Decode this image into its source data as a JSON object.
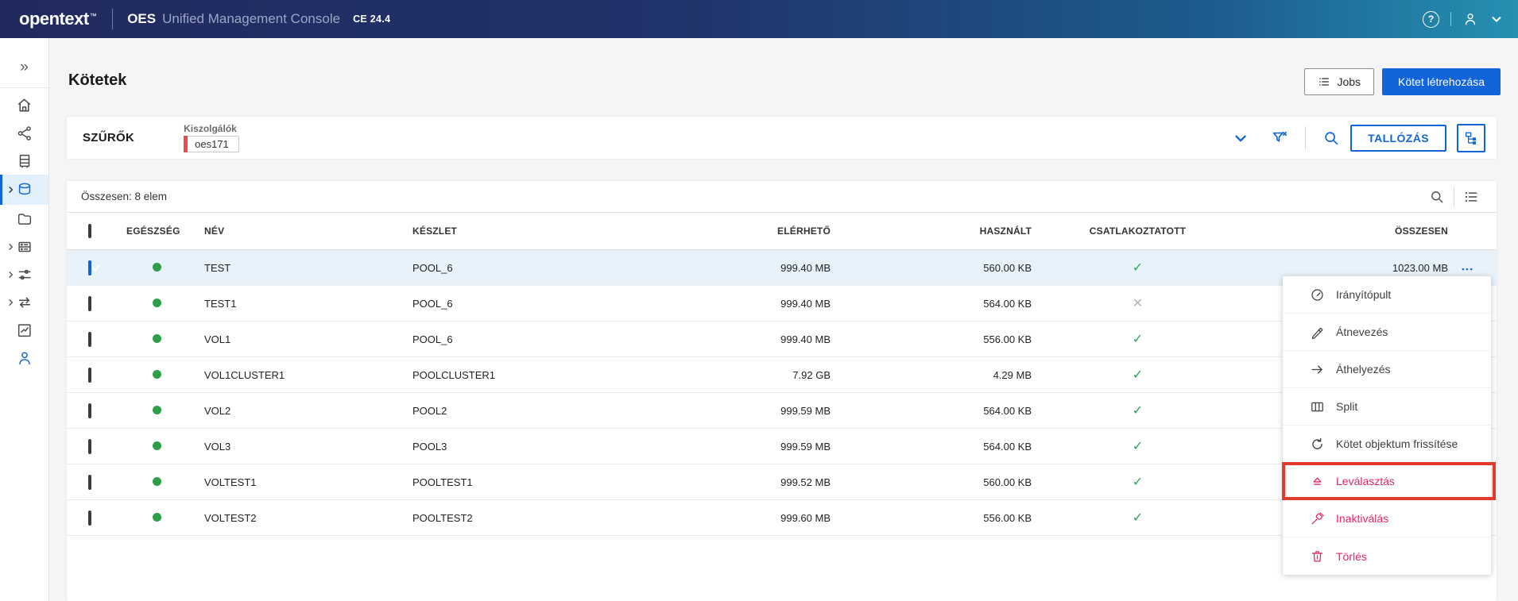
{
  "header": {
    "logo": "opentext",
    "trademark": "™",
    "app_bold": "OES",
    "app_name": "Unified Management Console",
    "version": "CE 24.4"
  },
  "toolbar": {
    "title": "Kötetek",
    "jobs_label": "Jobs",
    "create_label": "Kötet létrehozása"
  },
  "filter_bar": {
    "title": "SZŰRŐK",
    "field_label": "Kiszolgálók",
    "chip_value": "oes171",
    "browse_label": "TALLÓZÁS"
  },
  "table": {
    "summary": "Összesen: 8 elem",
    "columns": {
      "health": "EGÉSZSÉG",
      "name": "NÉV",
      "pool": "KÉSZLET",
      "available": "ELÉRHETŐ",
      "used": "HASZNÁLT",
      "mounted": "CSATLAKOZTATOTT",
      "total": "ÖSSZESEN"
    },
    "rows": [
      {
        "name": "TEST",
        "pool": "POOL_6",
        "available": "999.40 MB",
        "used": "560.00 KB",
        "mounted": "yes",
        "total": "1023.00 MB",
        "selected": true
      },
      {
        "name": "TEST1",
        "pool": "POOL_6",
        "available": "999.40 MB",
        "used": "564.00 KB",
        "mounted": "no",
        "total": "",
        "selected": false
      },
      {
        "name": "VOL1",
        "pool": "POOL_6",
        "available": "999.40 MB",
        "used": "556.00 KB",
        "mounted": "yes",
        "total": "",
        "selected": false
      },
      {
        "name": "VOL1CLUSTER1",
        "pool": "POOLCLUSTER1",
        "available": "7.92 GB",
        "used": "4.29 MB",
        "mounted": "yes",
        "total": "",
        "selected": false
      },
      {
        "name": "VOL2",
        "pool": "POOL2",
        "available": "999.59 MB",
        "used": "564.00 KB",
        "mounted": "yes",
        "total": "",
        "selected": false
      },
      {
        "name": "VOL3",
        "pool": "POOL3",
        "available": "999.59 MB",
        "used": "564.00 KB",
        "mounted": "yes",
        "total": "",
        "selected": false
      },
      {
        "name": "VOLTEST1",
        "pool": "POOLTEST1",
        "available": "999.52 MB",
        "used": "560.00 KB",
        "mounted": "yes",
        "total": "",
        "selected": false
      },
      {
        "name": "VOLTEST2",
        "pool": "POOLTEST2",
        "available": "999.60 MB",
        "used": "556.00 KB",
        "mounted": "yes",
        "total": "",
        "selected": false
      }
    ]
  },
  "context_menu": {
    "items": [
      {
        "label": "Irányítópult",
        "icon": "dashboard-icon"
      },
      {
        "label": "Átnevezés",
        "icon": "rename-icon"
      },
      {
        "label": "Áthelyezés",
        "icon": "move-icon"
      },
      {
        "label": "Split",
        "icon": "split-icon"
      },
      {
        "label": "Kötet objektum frissítése",
        "icon": "refresh-icon"
      },
      {
        "label": "Leválasztás",
        "icon": "eject-icon",
        "danger": true,
        "annotated": true
      },
      {
        "label": "Inaktiválás",
        "icon": "deactivate-icon",
        "danger": true
      },
      {
        "label": "Törlés",
        "icon": "delete-icon",
        "danger": true
      }
    ]
  },
  "icons": {
    "header": [
      "help-icon",
      "user-icon",
      "chevron-down-icon"
    ],
    "sidebar": [
      "expand-icon",
      "home-icon",
      "share-icon",
      "server-icon",
      "volumes-icon",
      "folder-icon",
      "storage-icon",
      "settings-sliders-icon",
      "sync-arrows-icon",
      "chart-icon",
      "user-icon"
    ],
    "filter_bar": [
      "chevron-down-icon",
      "clear-filter-icon",
      "search-icon",
      "tree-view-icon"
    ],
    "table_toolbar": [
      "search-icon",
      "list-view-icon"
    ]
  },
  "colors": {
    "accent_blue": "#1264d9",
    "danger_pink": "#e3256c",
    "annotation_red": "#e23b2e",
    "health_green": "#2e9e4b",
    "selected_row_bg": "#e8f2fb",
    "header_navy": "#212a5e",
    "header_teal": "#2590b2"
  }
}
